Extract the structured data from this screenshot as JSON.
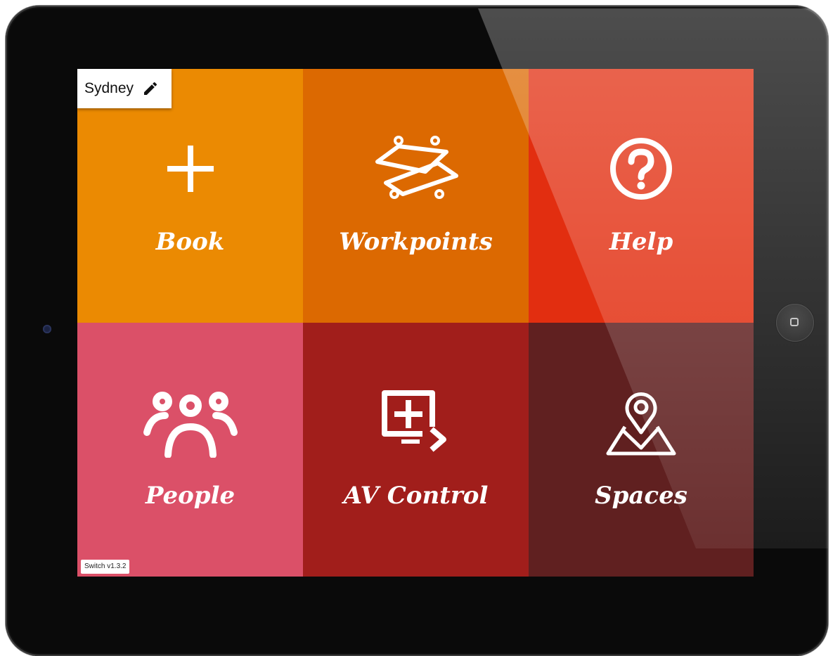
{
  "location": {
    "name": "Sydney",
    "edit_icon": "pencil-icon"
  },
  "version": "Switch v1.3.2",
  "tiles": [
    {
      "label": "Book",
      "icon": "plus-icon",
      "color": "#EB8A02"
    },
    {
      "label": "Workpoints",
      "icon": "desks-icon",
      "color": "#DC6901"
    },
    {
      "label": "Help",
      "icon": "question-circle-icon",
      "color": "#E22E10"
    },
    {
      "label": "People",
      "icon": "people-group-icon",
      "color": "#DB5068"
    },
    {
      "label": "AV Control",
      "icon": "screen-add-icon",
      "color": "#A11E1B"
    },
    {
      "label": "Spaces",
      "icon": "map-pin-icon",
      "color": "#602020"
    }
  ]
}
